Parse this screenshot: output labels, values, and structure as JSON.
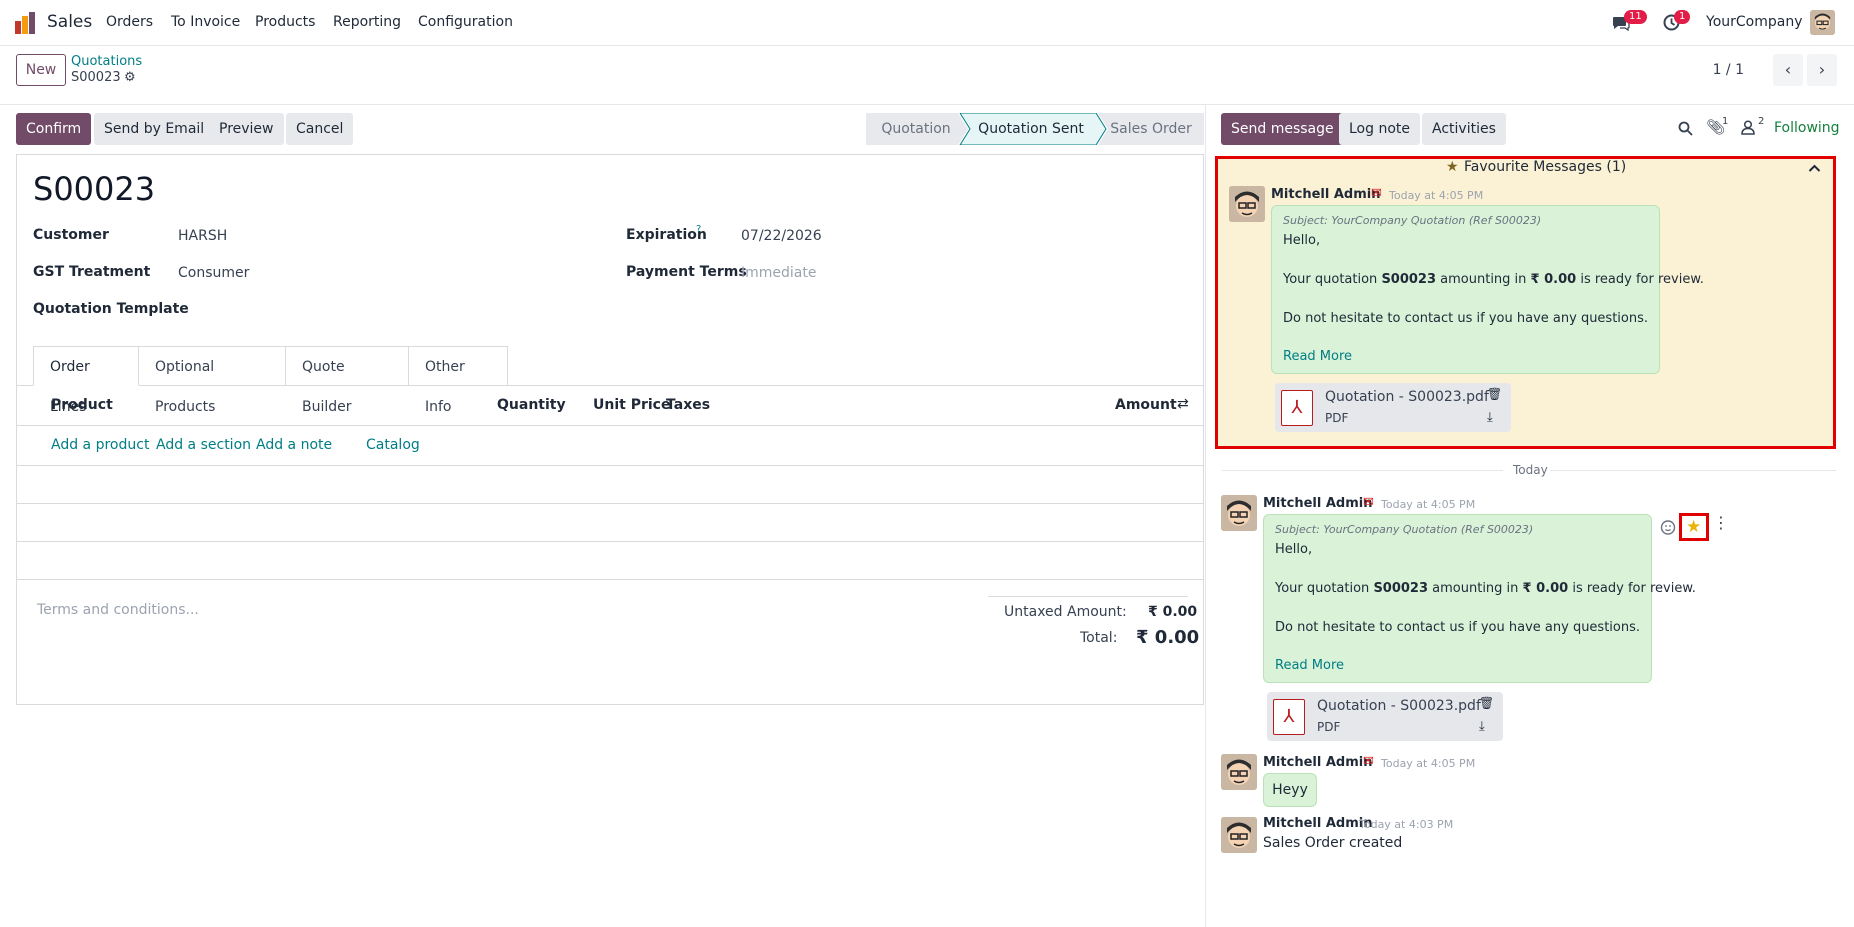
{
  "nav": {
    "app": "Sales",
    "items": [
      "Orders",
      "To Invoice",
      "Products",
      "Reporting",
      "Configuration"
    ],
    "messages_badge": "11",
    "activity_badge": "1",
    "company": "YourCompany"
  },
  "control": {
    "new_label": "New",
    "breadcrumb": "Quotations",
    "record": "S00023",
    "pager": "1 / 1"
  },
  "actions": {
    "confirm": "Confirm",
    "send_email": "Send by Email",
    "preview": "Preview",
    "cancel": "Cancel"
  },
  "stages": [
    "Quotation",
    "Quotation Sent",
    "Sales Order"
  ],
  "form": {
    "title": "S00023",
    "customer_label": "Customer",
    "customer": "HARSH",
    "gst_label": "GST Treatment",
    "gst": "Consumer",
    "template_label": "Quotation Template",
    "expiration_label": "Expiration",
    "expiration_help": "?",
    "expiration": "07/22/2026",
    "terms_label": "Payment Terms",
    "terms_placeholder": "Immediate"
  },
  "tabs": [
    "Order Lines",
    "Optional Products",
    "Quote Builder",
    "Other Info"
  ],
  "lines": {
    "headers": {
      "product": "Product",
      "quantity": "Quantity",
      "unit_price": "Unit Price",
      "taxes": "Taxes",
      "amount": "Amount"
    },
    "add_product": "Add a product",
    "add_section": "Add a section",
    "add_note": "Add a note",
    "catalog": "Catalog",
    "terms_placeholder": "Terms and conditions...",
    "untaxed_label": "Untaxed Amount:",
    "untaxed": "₹ 0.00",
    "total_label": "Total:",
    "total": "₹ 0.00"
  },
  "chatter": {
    "send_message": "Send message",
    "log_note": "Log note",
    "activities": "Activities",
    "attach_count": "1",
    "follower_count": "2",
    "following": "Following",
    "fav_header": "Favourite Messages (1)",
    "today": "Today",
    "messages": [
      {
        "author": "Mitchell Admin",
        "time": "Today at 4:05 PM",
        "subject": "Subject: YourCompany Quotation (Ref S00023)",
        "hello": "Hello,",
        "body_pre": "Your quotation ",
        "body_ref": "S00023",
        "body_mid": " amounting in ",
        "body_amt": "₹ 0.00",
        "body_post": " is ready for review.",
        "body2": "Do not hesitate to contact us if you have any questions.",
        "read_more": "Read More",
        "attachment": "Quotation - S00023.pdf",
        "attachment_type": "PDF"
      },
      {
        "author": "Mitchell Admin",
        "time": "Today at 4:05 PM",
        "text": "Heyy"
      },
      {
        "author": "Mitchell Admin",
        "time": "Today at 4:03 PM",
        "text": "Sales Order created"
      }
    ]
  }
}
